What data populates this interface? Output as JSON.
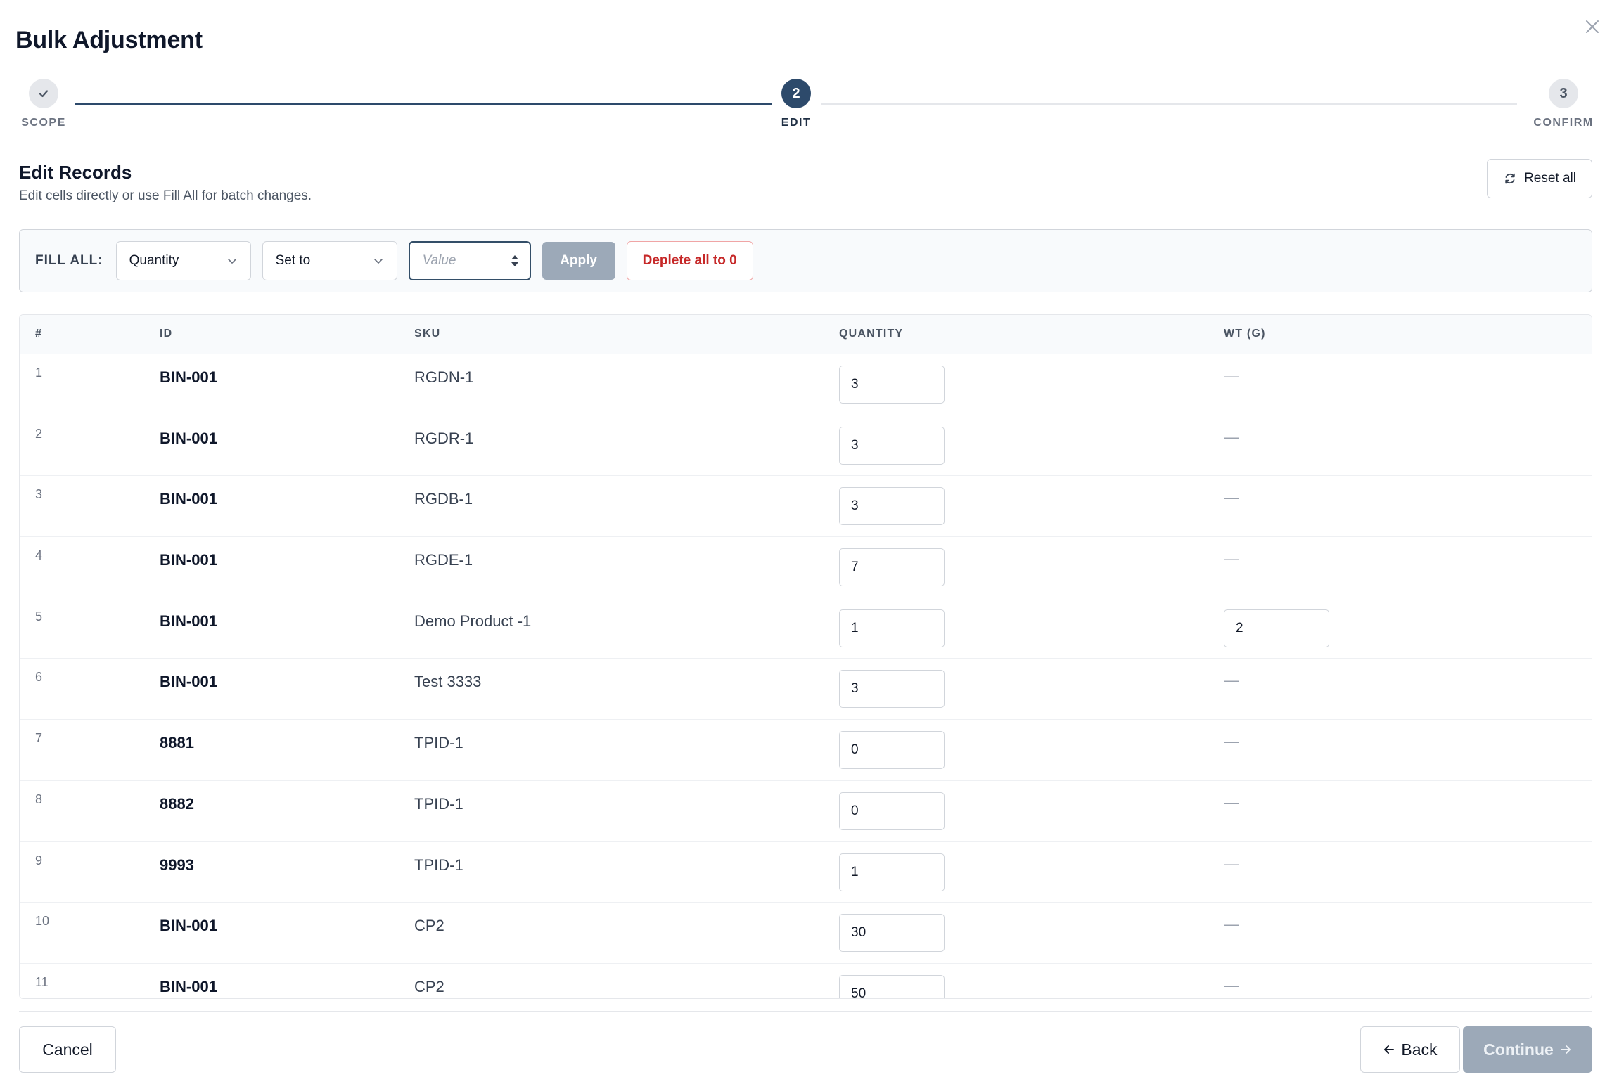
{
  "dialog": {
    "title": "Bulk Adjustment",
    "close_icon": "close-icon"
  },
  "stepper": {
    "steps": [
      {
        "number": "",
        "label": "SCOPE",
        "state": "completed",
        "icon": "check-icon"
      },
      {
        "number": "2",
        "label": "EDIT",
        "state": "active"
      },
      {
        "number": "3",
        "label": "CONFIRM",
        "state": "pending"
      }
    ],
    "colors": {
      "active": "#2d4a6b",
      "pending": "#e5e7eb",
      "completed": "#e5e7eb"
    }
  },
  "section": {
    "title": "Edit Records",
    "subtitle": "Edit cells directly or use Fill All for batch changes.",
    "reset_label": "Reset all",
    "reset_icon": "refresh-icon"
  },
  "fill_all": {
    "label": "FILL ALL:",
    "field_select": "Quantity",
    "operation_select": "Set to",
    "value_placeholder": "Value",
    "apply_label": "Apply",
    "deplete_label": "Deplete all to 0"
  },
  "table": {
    "headers": {
      "num": "#",
      "id": "ID",
      "sku": "SKU",
      "quantity": "QUANTITY",
      "wt": "WT (G)"
    },
    "rows": [
      {
        "num": "1",
        "id": "BIN-001",
        "sku": "RGDN-1",
        "quantity": "3",
        "wt": "—"
      },
      {
        "num": "2",
        "id": "BIN-001",
        "sku": "RGDR-1",
        "quantity": "3",
        "wt": "—"
      },
      {
        "num": "3",
        "id": "BIN-001",
        "sku": "RGDB-1",
        "quantity": "3",
        "wt": "—"
      },
      {
        "num": "4",
        "id": "BIN-001",
        "sku": "RGDE-1",
        "quantity": "7",
        "wt": "—"
      },
      {
        "num": "5",
        "id": "BIN-001",
        "sku": "Demo Product -1",
        "quantity": "1",
        "wt": "2"
      },
      {
        "num": "6",
        "id": "BIN-001",
        "sku": "Test 3333",
        "quantity": "3",
        "wt": "—"
      },
      {
        "num": "7",
        "id": "8881",
        "sku": "TPID-1",
        "quantity": "0",
        "wt": "—"
      },
      {
        "num": "8",
        "id": "8882",
        "sku": "TPID-1",
        "quantity": "0",
        "wt": "—"
      },
      {
        "num": "9",
        "id": "9993",
        "sku": "TPID-1",
        "quantity": "1",
        "wt": "—"
      },
      {
        "num": "10",
        "id": "BIN-001",
        "sku": "CP2",
        "quantity": "30",
        "wt": "—"
      },
      {
        "num": "11",
        "id": "BIN-001",
        "sku": "CP2",
        "quantity": "50",
        "wt": "—"
      }
    ]
  },
  "footer": {
    "cancel_label": "Cancel",
    "back_label": "Back",
    "continue_label": "Continue"
  }
}
